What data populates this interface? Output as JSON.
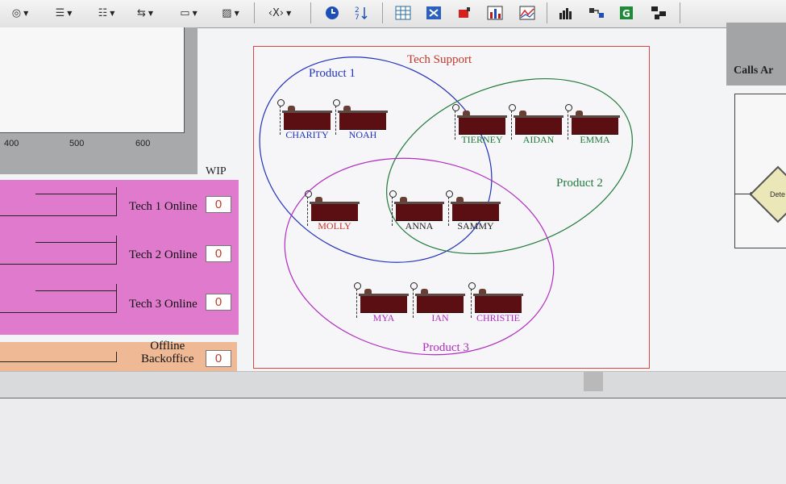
{
  "toolbar": {
    "items": [
      {
        "name": "shape-tool",
        "glyph": "◎"
      },
      {
        "name": "line-style",
        "glyph": "☰"
      },
      {
        "name": "line-dash",
        "glyph": "☷"
      },
      {
        "name": "line-arrows",
        "glyph": "⇆"
      },
      {
        "name": "line-pattern",
        "glyph": "▭"
      },
      {
        "name": "fill-pattern",
        "glyph": "▨"
      },
      {
        "name": "code-view",
        "glyph": "‹X›"
      }
    ]
  },
  "plot": {
    "x_ticks": [
      "400",
      "500",
      "600"
    ]
  },
  "wip_label": "WIP",
  "queues": [
    {
      "label": "Tech 1 Online",
      "count": "0"
    },
    {
      "label": "Tech 2 Online",
      "count": "0"
    },
    {
      "label": "Tech 3 Online",
      "count": "0"
    }
  ],
  "offline": {
    "label_line1": "Offline",
    "label_line2": "Backoffice",
    "count": "0"
  },
  "tech_support": {
    "title": "Tech Support",
    "title_color": "#c0392b",
    "sets": [
      {
        "label": "Product 1",
        "color": "#2233bb"
      },
      {
        "label": "Product 2",
        "color": "#1f7a3a"
      },
      {
        "label": "Product 3",
        "color": "#b02cc0"
      }
    ],
    "agents": [
      {
        "name": "CHARITY",
        "color": "#2233bb"
      },
      {
        "name": "NOAH",
        "color": "#2233bb"
      },
      {
        "name": "TIERNEY",
        "color": "#1f7a3a"
      },
      {
        "name": "AIDAN",
        "color": "#1f7a3a"
      },
      {
        "name": "EMMA",
        "color": "#1f7a3a"
      },
      {
        "name": "MOLLY",
        "color": "#c0392b"
      },
      {
        "name": "ANNA",
        "color": "#222222"
      },
      {
        "name": "SAMMY",
        "color": "#222222"
      },
      {
        "name": "MYA",
        "color": "#b02cc0"
      },
      {
        "name": "IAN",
        "color": "#b02cc0"
      },
      {
        "name": "CHRISTIE",
        "color": "#b02cc0"
      }
    ]
  },
  "right_panel": {
    "header": "Calls Ar",
    "diamond_label": "Dete"
  }
}
